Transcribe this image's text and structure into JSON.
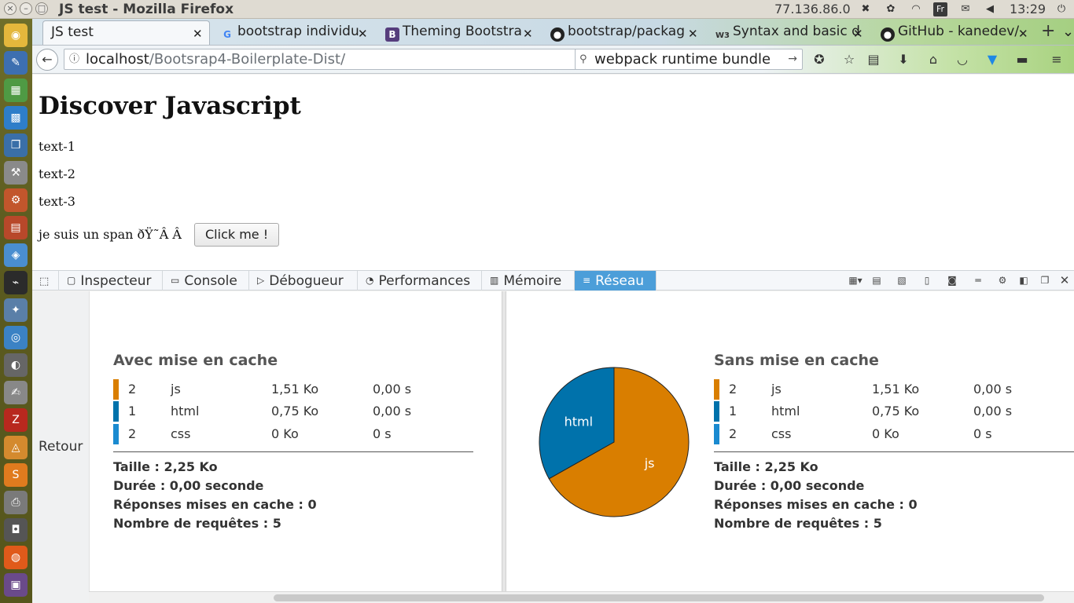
{
  "window": {
    "title": "JS test - Mozilla Firefox",
    "ip": "77.136.86.0",
    "keyboard_layout": "Fr",
    "clock": "13:29"
  },
  "tabs": [
    {
      "title": "JS test",
      "favicon": ""
    },
    {
      "title": "bootstrap individu",
      "favicon": "G"
    },
    {
      "title": "Theming Bootstra",
      "favicon": "B"
    },
    {
      "title": "bootstrap/packag",
      "favicon": "github-icon"
    },
    {
      "title": "Syntax and basic d",
      "favicon": "W3"
    },
    {
      "title": "GitHub - kanedev/",
      "favicon": "github-icon"
    }
  ],
  "url": {
    "host": "localhost",
    "path": "/Bootsrap4-Boilerplate-Dist/"
  },
  "search": {
    "value": "webpack runtime bundle"
  },
  "page": {
    "heading": "Discover Javascript",
    "texts": [
      "text-1",
      "text-2",
      "text-3"
    ],
    "span_text": "je suis un span ðŸ˜Â Â",
    "button_label": "Click me !"
  },
  "devtools": {
    "tabs": [
      "Inspecteur",
      "Console",
      "Débogueur",
      "Performances",
      "Mémoire",
      "Réseau"
    ],
    "active_tab": "Réseau",
    "back_label": "Retour",
    "colors": {
      "js": "#d97e00",
      "html": "#0072ab",
      "css": "#1a8ad0"
    },
    "cached": {
      "title": "Avec mise en cache",
      "rows": [
        {
          "count": "2",
          "type": "js",
          "size": "1,51 Ko",
          "time": "0,00 s"
        },
        {
          "count": "1",
          "type": "html",
          "size": "0,75 Ko",
          "time": "0,00 s"
        },
        {
          "count": "2",
          "type": "css",
          "size": "0 Ko",
          "time": "0 s"
        }
      ],
      "size": "Taille : 2,25 Ko",
      "duration": "Durée : 0,00 seconde",
      "cached_responses": "Réponses mises en cache : 0",
      "requests": "Nombre de requêtes : 5"
    },
    "uncached": {
      "title": "Sans mise en cache",
      "rows": [
        {
          "count": "2",
          "type": "js",
          "size": "1,51 Ko",
          "time": "0,00 s"
        },
        {
          "count": "1",
          "type": "html",
          "size": "0,75 Ko",
          "time": "0,00 s"
        },
        {
          "count": "2",
          "type": "css",
          "size": "0 Ko",
          "time": "0 s"
        }
      ],
      "size": "Taille : 2,25 Ko",
      "duration": "Durée : 0,00 seconde",
      "cached_responses": "Réponses mises en cache : 0",
      "requests": "Nombre de requêtes : 5"
    }
  },
  "chart_data": {
    "type": "pie",
    "labels": [
      "js",
      "html"
    ],
    "values": [
      1.51,
      0.75
    ],
    "colors": [
      "#d97e00",
      "#0072ab"
    ]
  }
}
